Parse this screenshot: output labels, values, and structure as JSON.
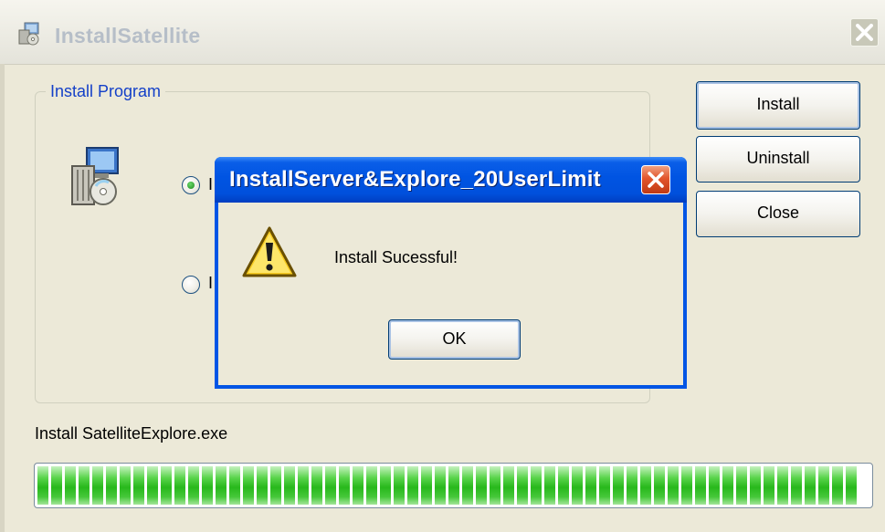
{
  "main_window": {
    "title": "InstallSatellite",
    "group_label": "Install Program",
    "radio_options": [
      {
        "label": "I",
        "selected": true
      },
      {
        "label": "I",
        "selected": false
      }
    ],
    "buttons": {
      "install": "Install",
      "uninstall": "Uninstall",
      "close": "Close"
    },
    "status_text": "Install SatelliteExplore.exe",
    "progress_percent": 100
  },
  "dialog": {
    "title": "InstallServer&Explore_20UserLimit",
    "message": "Install Sucessful!",
    "ok_label": "OK",
    "icon": "warning-icon"
  },
  "icons": {
    "app": "installer-icon",
    "setup": "setup-package-icon",
    "warning": "warning-icon",
    "close": "close-icon"
  },
  "colors": {
    "window_bg": "#ece9d8",
    "dialog_title_blue": "#0054e2",
    "legend_blue": "#1440c8",
    "close_red": "#e2552c",
    "progress_green": "#28b81c"
  }
}
